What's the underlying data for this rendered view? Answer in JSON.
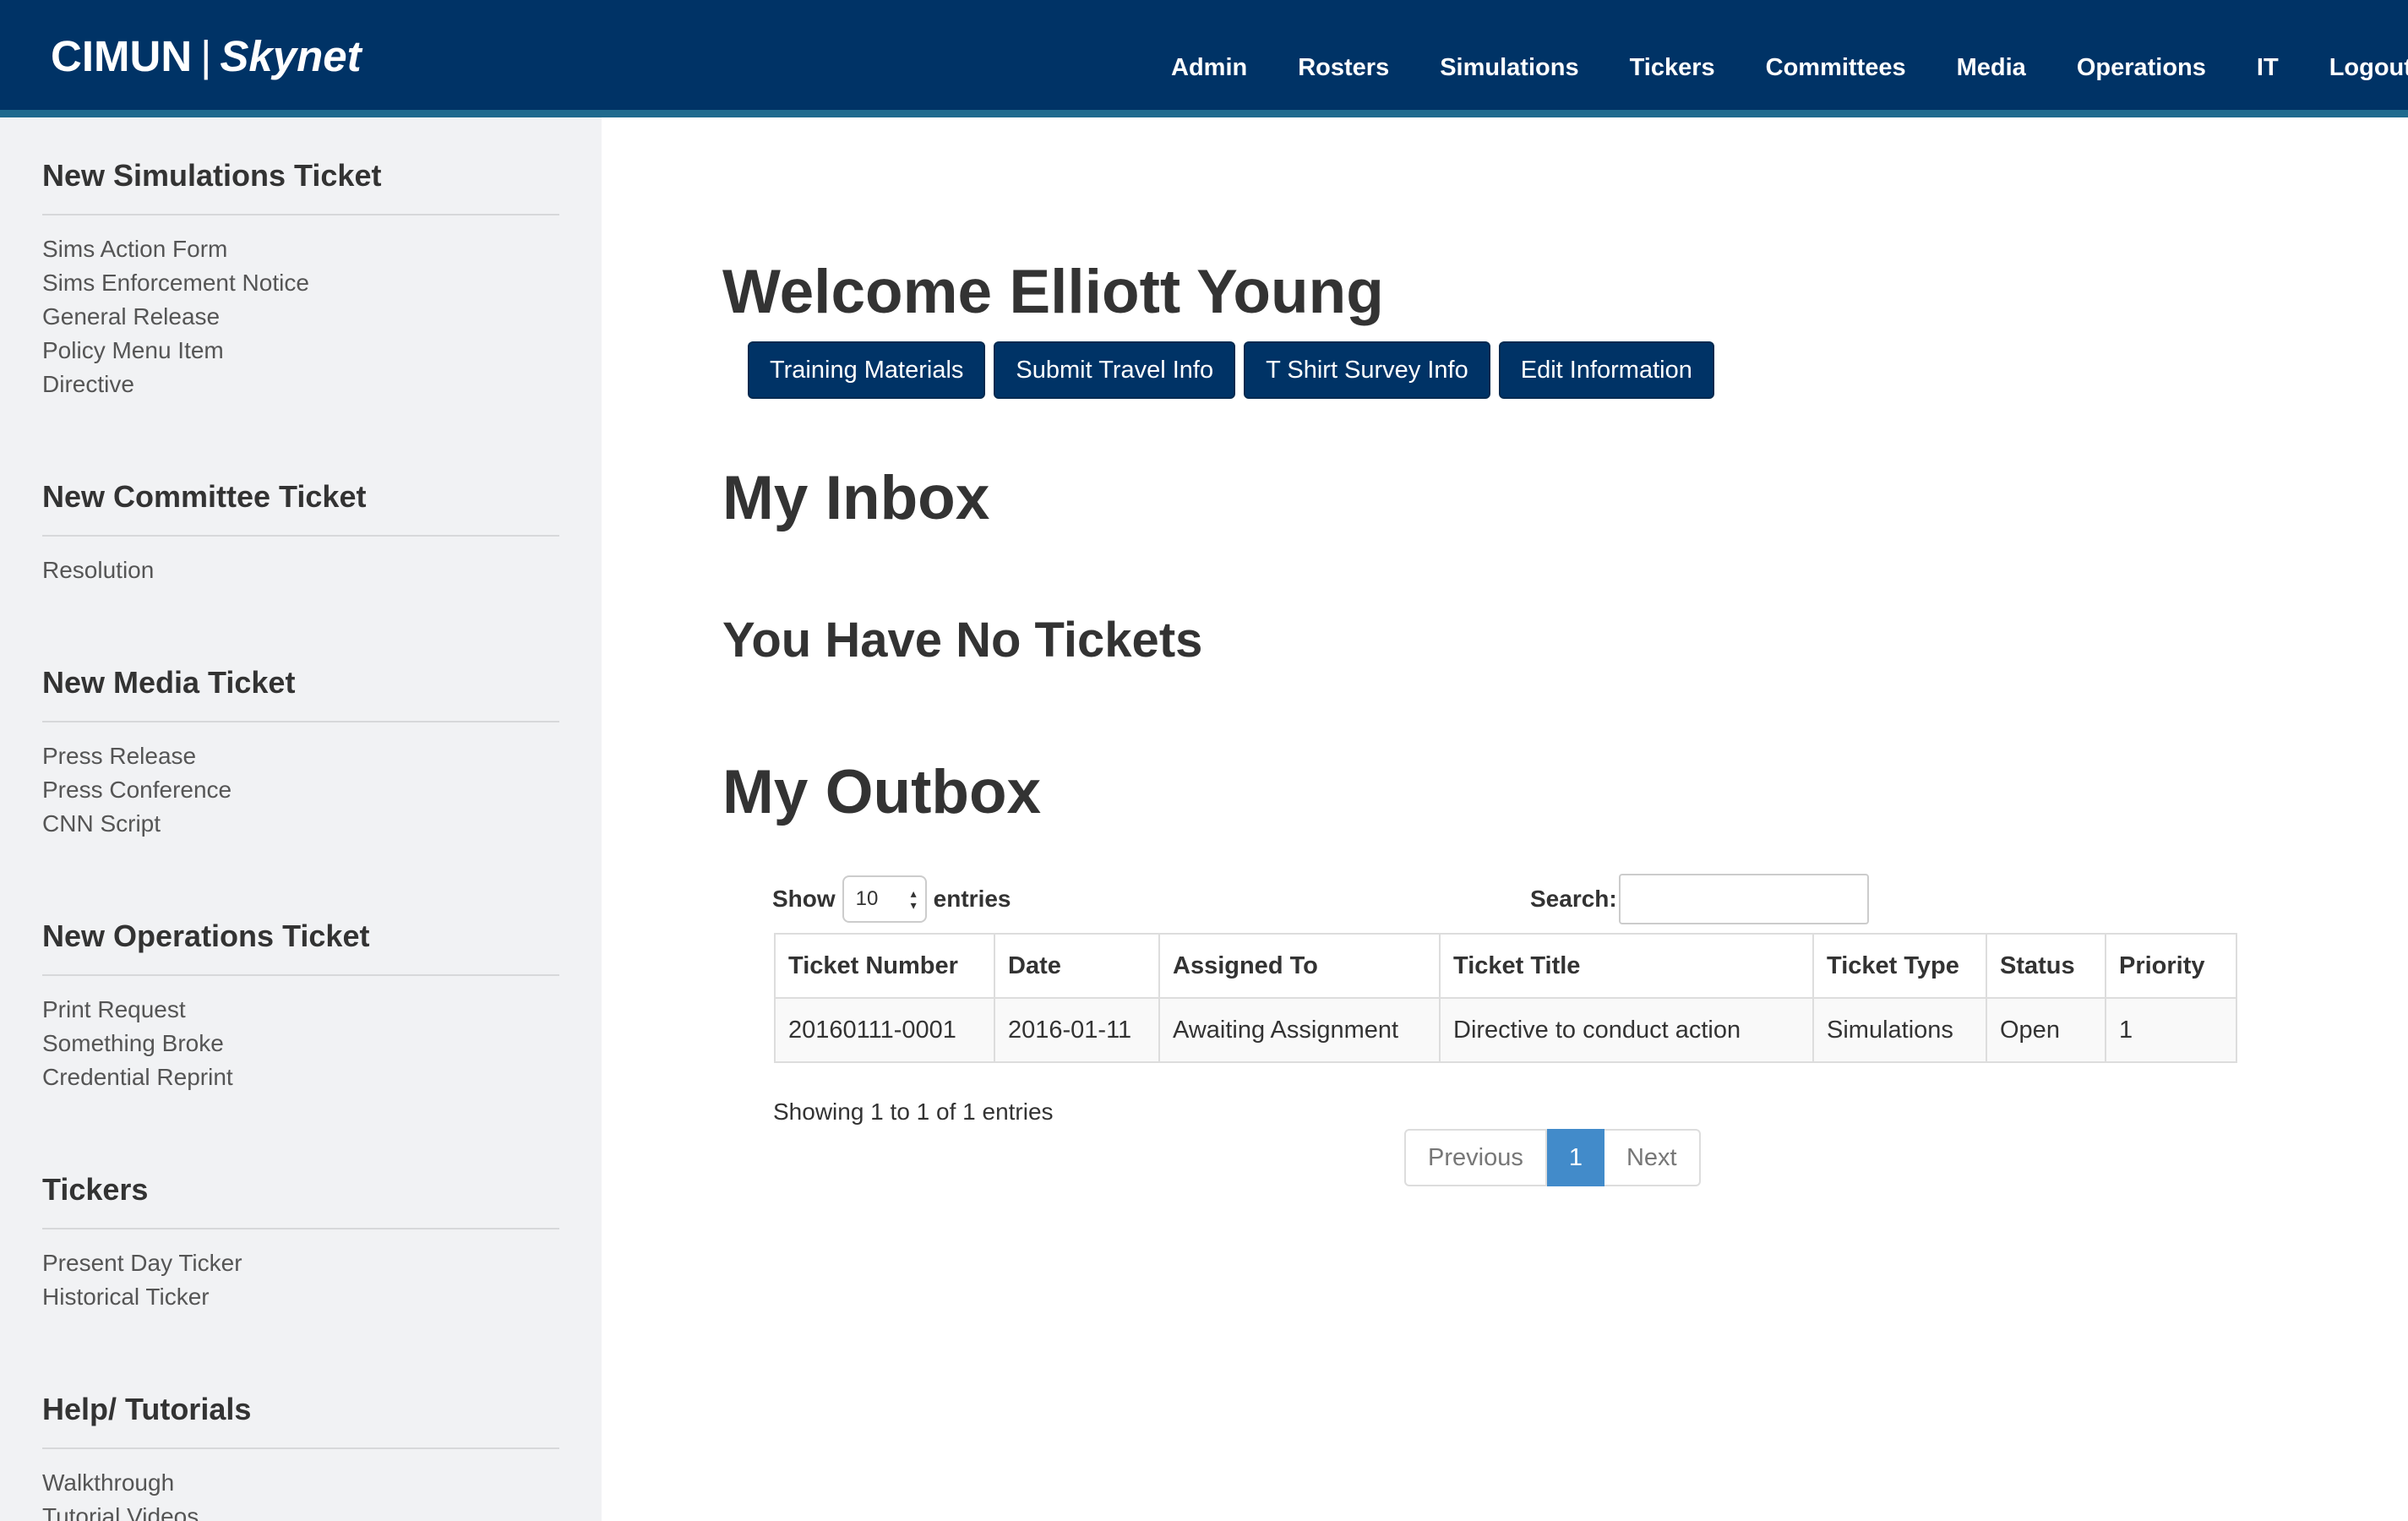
{
  "header": {
    "brand": "CIMUN",
    "brand_separator": "|",
    "brand_sub": "Skynet",
    "nav": [
      "Admin",
      "Rosters",
      "Simulations",
      "Tickers",
      "Committees",
      "Media",
      "Operations",
      "IT",
      "Logout"
    ]
  },
  "sidebar": {
    "sections": [
      {
        "title": "New Simulations Ticket",
        "links": [
          "Sims Action Form",
          "Sims Enforcement Notice",
          "General Release",
          "Policy Menu Item",
          "Directive"
        ]
      },
      {
        "title": "New Committee Ticket",
        "links": [
          "Resolution"
        ]
      },
      {
        "title": "New Media Ticket",
        "links": [
          "Press Release",
          "Press Conference",
          "CNN Script"
        ]
      },
      {
        "title": "New Operations Ticket",
        "links": [
          "Print Request",
          "Something Broke",
          "Credential Reprint"
        ]
      },
      {
        "title": "Tickers",
        "links": [
          "Present Day Ticker",
          "Historical Ticker"
        ]
      },
      {
        "title": "Help/ Tutorials",
        "links": [
          "Walkthrough",
          "Tutorial Videos"
        ]
      }
    ]
  },
  "main": {
    "welcome": "Welcome Elliott Young",
    "buttons": [
      "Training Materials",
      "Submit Travel Info",
      "T Shirt Survey Info",
      "Edit Information"
    ],
    "inbox_title": "My Inbox",
    "inbox_empty": "You Have No Tickets",
    "outbox_title": "My Outbox",
    "show_label": "Show",
    "entries_value": "10",
    "entries_label": "entries",
    "search_label": "Search:",
    "search_value": "",
    "table": {
      "columns": [
        "Ticket Number",
        "Date",
        "Assigned To",
        "Ticket Title",
        "Ticket Type",
        "Status",
        "Priority"
      ],
      "rows": [
        [
          "20160111-0001",
          "2016-01-11",
          "Awaiting Assignment",
          "Directive to conduct action",
          "Simulations",
          "Open",
          "1"
        ]
      ]
    },
    "info": "Showing 1 to 1 of 1 entries",
    "pagination": {
      "previous": "Previous",
      "current": "1",
      "next": "Next"
    }
  },
  "colors": {
    "header_bg": "#003366",
    "header_stripe": "#1f6a8e",
    "sidebar_bg": "#f1f2f4",
    "button_bg": "#003366",
    "pager_active": "#428bca"
  }
}
